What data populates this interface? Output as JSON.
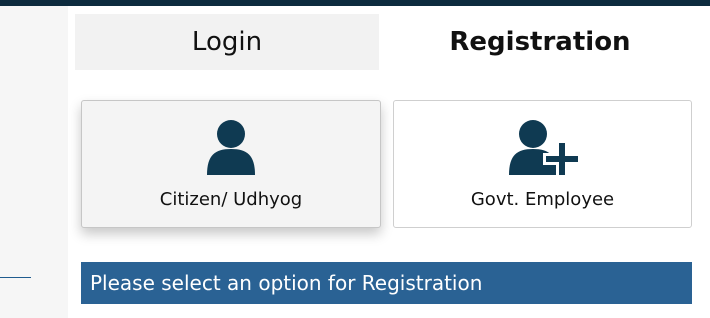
{
  "tabs": {
    "login_label": "Login",
    "registration_label": "Registration",
    "active": "Registration"
  },
  "options": [
    {
      "label": "Citizen/ Udhyog",
      "icon": "user-icon",
      "selected": true
    },
    {
      "label": "Govt. Employee",
      "icon": "user-plus-icon",
      "selected": false
    }
  ],
  "notice": {
    "text": "Please select an option for Registration"
  },
  "colors": {
    "topbar": "#0d2b3e",
    "icon": "#0f3a52",
    "notice_bg": "#2a6294",
    "accent_line": "#1f5c8f"
  }
}
